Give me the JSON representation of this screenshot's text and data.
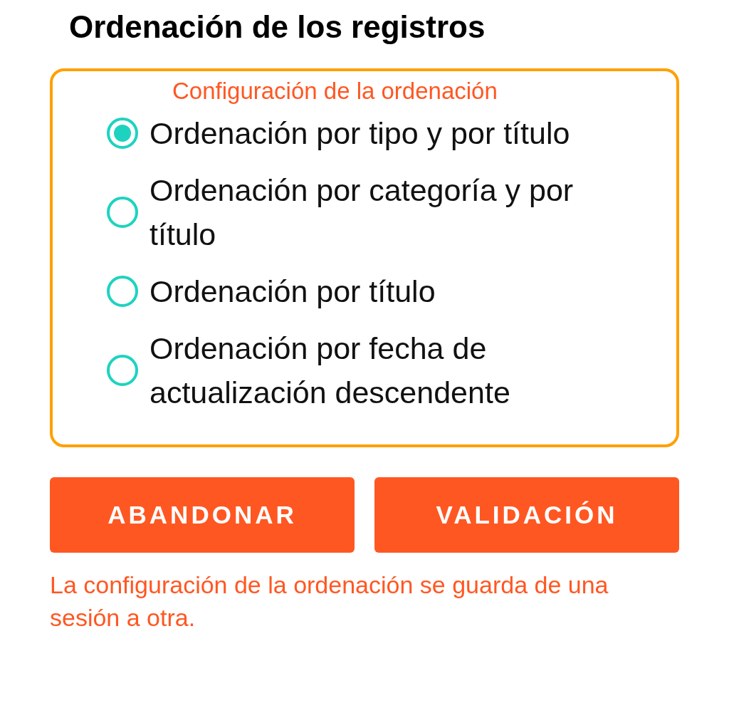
{
  "title": "Ordenación de los registros",
  "sort_settings": {
    "legend": "Configuración de la ordenación",
    "options": [
      {
        "label": "Ordenación por tipo y por título",
        "selected": true
      },
      {
        "label": "Ordenación por categoría y por título",
        "selected": false
      },
      {
        "label": "Ordenación por título",
        "selected": false
      },
      {
        "label": "Ordenación por fecha de actualización descendente",
        "selected": false
      }
    ]
  },
  "buttons": [
    {
      "label": "ABANDONAR"
    },
    {
      "label": "VALIDACIÓN"
    }
  ],
  "note": "La configuración de la ordenación se guarda de una sesión a otra."
}
